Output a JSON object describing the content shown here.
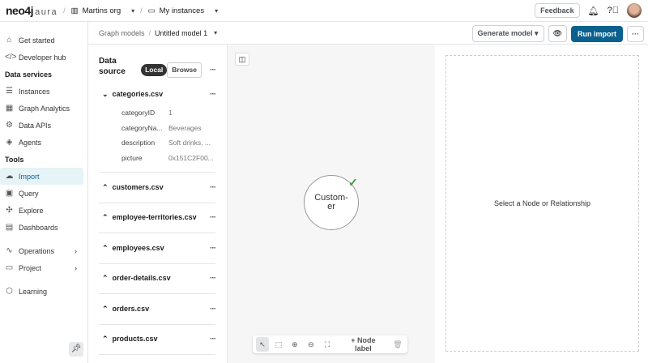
{
  "top": {
    "logo": "neo4j",
    "logo_sub": "aura",
    "org": "Martins org",
    "instances": "My instances",
    "feedback": "Feedback"
  },
  "sidebar": {
    "items": [
      {
        "label": "Get started",
        "icon": "home-icon",
        "glyph": "⌂"
      },
      {
        "label": "Developer hub",
        "icon": "code-icon",
        "glyph": "</>"
      },
      {
        "section": "Data services"
      },
      {
        "label": "Instances",
        "icon": "database-icon",
        "glyph": "☰"
      },
      {
        "label": "Graph Analytics",
        "icon": "analytics-icon",
        "glyph": "▦"
      },
      {
        "label": "Data APIs",
        "icon": "api-icon",
        "glyph": "⚙"
      },
      {
        "label": "Agents",
        "icon": "agent-icon",
        "glyph": "◈"
      },
      {
        "section": "Tools"
      },
      {
        "label": "Import",
        "icon": "import-icon",
        "glyph": "☁",
        "active": true
      },
      {
        "label": "Query",
        "icon": "query-icon",
        "glyph": "▣"
      },
      {
        "label": "Explore",
        "icon": "explore-icon",
        "glyph": "✣"
      },
      {
        "label": "Dashboards",
        "icon": "dashboard-icon",
        "glyph": "▤"
      },
      {
        "label": "Operations",
        "icon": "operations-icon",
        "glyph": "∿",
        "chevron": true
      },
      {
        "label": "Project",
        "icon": "folder-icon",
        "glyph": "▭",
        "chevron": true
      },
      {
        "label": "Learning",
        "icon": "learning-icon",
        "glyph": "⬡"
      }
    ]
  },
  "subheader": {
    "parent": "Graph models",
    "current": "Untitled model 1",
    "generate": "Generate model",
    "run": "Run import"
  },
  "datasource": {
    "title1": "Data",
    "title2": "source",
    "local": "Local",
    "browse": "Browse",
    "files": [
      {
        "name": "categories.csv",
        "expanded": true,
        "fields": [
          [
            "categoryID",
            "1"
          ],
          [
            "categoryNa...",
            "Beverages"
          ],
          [
            "description",
            "Soft drinks, ..."
          ],
          [
            "picture",
            "0x151C2F00..."
          ]
        ]
      },
      {
        "name": "customers.csv"
      },
      {
        "name": "employee-territories.csv"
      },
      {
        "name": "employees.csv"
      },
      {
        "name": "order-details.csv"
      },
      {
        "name": "orders.csv"
      },
      {
        "name": "products.csv"
      }
    ]
  },
  "canvas": {
    "node_line1": "Custom-",
    "node_line2": "er",
    "node_label": "+ Node label"
  },
  "details": {
    "empty": "Select a Node or Relationship"
  },
  "colors": {
    "accent": "#0a6190",
    "check": "#3a9a3a"
  }
}
